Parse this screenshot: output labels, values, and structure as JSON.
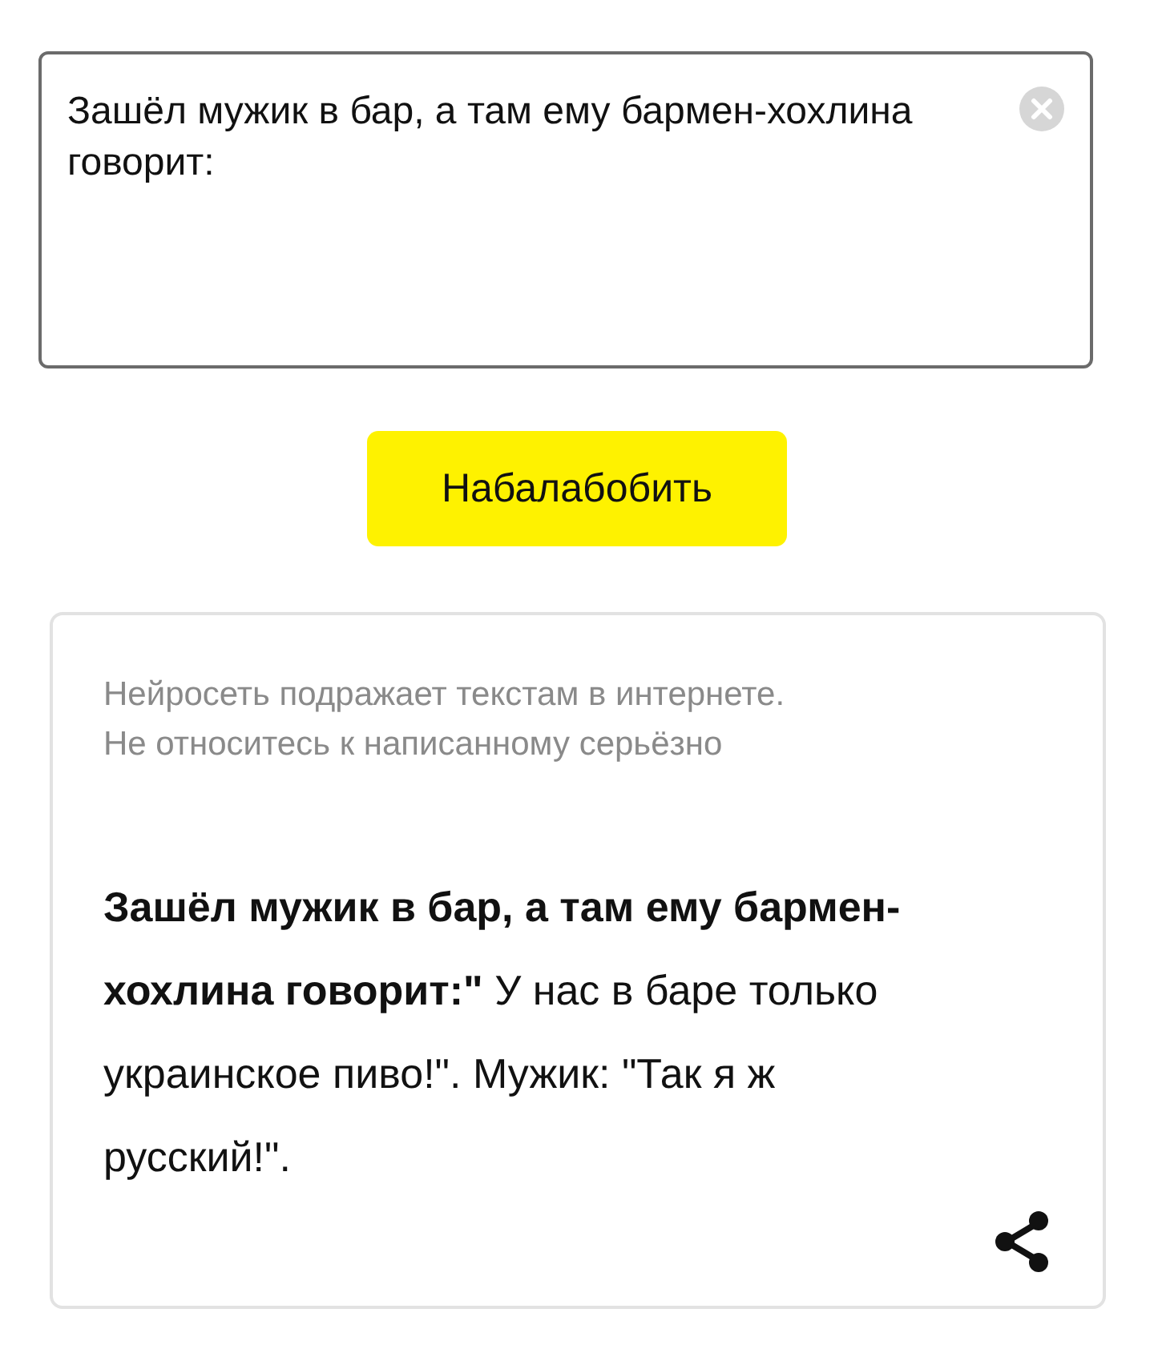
{
  "query": {
    "value": "Зашёл мужик в бар, а там ему бармен-хохлина говорит:"
  },
  "generate_button": {
    "label": "Набалабобить"
  },
  "result": {
    "disclaimer": [
      "Нейросеть подражает текстам в интернете.",
      "Не относитесь к написанному серьёзно"
    ],
    "text": "**Зашёл мужик в бар, а там ему бармен-хохлина говорит:\"** У нас в баре только украинское пиво!\". Мужик: \"Так я ж русский!\"."
  }
}
